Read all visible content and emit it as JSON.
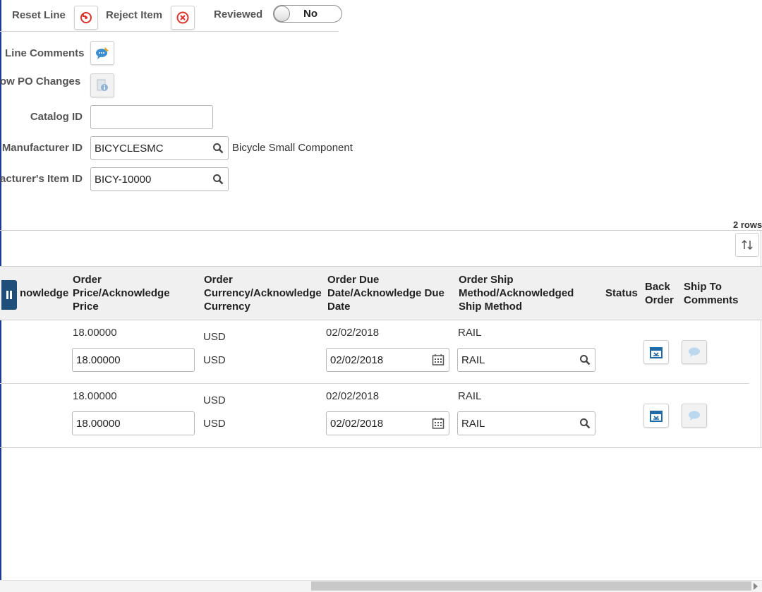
{
  "toolbar": {
    "reset_line_label": "Reset Line",
    "reject_item_label": "Reject Item",
    "reviewed_label": "Reviewed",
    "reviewed_value": "No"
  },
  "form": {
    "line_comments_label": "Line Comments",
    "show_po_changes_label": "ow PO Changes",
    "catalog_id_label": "Catalog ID",
    "catalog_id_value": "",
    "manufacturer_id_label": "Manufacturer ID",
    "manufacturer_id_value": "BICYCLESMC",
    "manufacturer_desc": "Bicycle Small Component",
    "mfr_item_id_label": "acturer's Item ID",
    "mfr_item_id_value": "BICY-10000"
  },
  "grid": {
    "row_count": "2 rows",
    "headers": {
      "acknowledge": "nowledge",
      "price": [
        "Order",
        "Price/Acknowledge",
        "Price"
      ],
      "currency": [
        "Order",
        "Currency/Acknowledge",
        "Currency"
      ],
      "due_date": [
        "Order Due",
        "Date/Acknowledge Due",
        "Date"
      ],
      "ship_method": [
        "Order Ship",
        "Method/Acknowledged",
        "Ship Method"
      ],
      "status": "Status",
      "back_order": [
        "Back",
        "Order"
      ],
      "ship_to_comments": [
        "Ship To",
        "Comments"
      ]
    },
    "rows": [
      {
        "order_price": "18.00000",
        "ack_price": "18.00000",
        "order_currency": "USD",
        "ack_currency": "USD",
        "order_due": "02/02/2018",
        "ack_due": "02/02/2018",
        "order_ship": "RAIL",
        "ack_ship": "RAIL"
      },
      {
        "order_price": "18.00000",
        "ack_price": "18.00000",
        "order_currency": "USD",
        "ack_currency": "USD",
        "order_due": "02/02/2018",
        "ack_due": "02/02/2018",
        "order_ship": "RAIL",
        "ack_ship": "RAIL"
      }
    ]
  },
  "colors": {
    "accent_blue": "#1f4e7a",
    "reset_icon_red": "#d9342b",
    "header_bg": "#f0f0f0"
  }
}
